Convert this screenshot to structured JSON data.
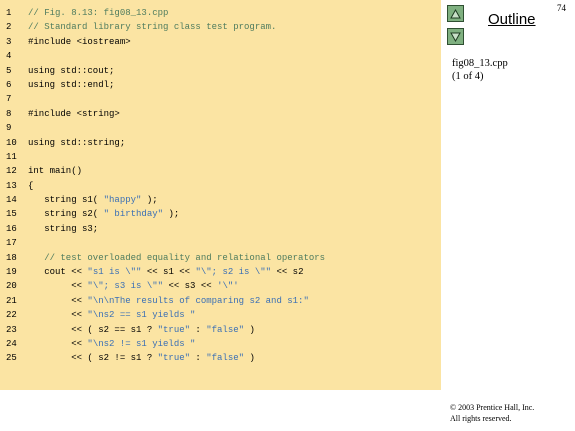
{
  "page_number": "74",
  "outline_label": "Outline",
  "nav": {
    "up_icon": "triangle-up-icon",
    "down_icon": "triangle-down-icon"
  },
  "file_info": {
    "filename": "fig08_13.cpp",
    "page_of": "(1 of 4)"
  },
  "copyright": {
    "line1": "© 2003 Prentice Hall, Inc.",
    "line2": "All rights reserved."
  },
  "colors": {
    "panel": "#fbe4a3",
    "comment": "#4f7c5e",
    "string": "#3a6fb5",
    "button": "#7fb080"
  },
  "code": [
    {
      "n": "1",
      "segs": [
        {
          "t": "// Fig. 8.13: fig08_13.cpp",
          "k": "comment"
        }
      ]
    },
    {
      "n": "2",
      "segs": [
        {
          "t": "// Standard library string class test program.",
          "k": "comment"
        }
      ]
    },
    {
      "n": "3",
      "segs": [
        {
          "t": "#include <iostream>",
          "k": "code"
        }
      ]
    },
    {
      "n": "4",
      "segs": []
    },
    {
      "n": "5",
      "segs": [
        {
          "t": "using std::cout;",
          "k": "code"
        }
      ]
    },
    {
      "n": "6",
      "segs": [
        {
          "t": "using std::endl;",
          "k": "code"
        }
      ]
    },
    {
      "n": "7",
      "segs": []
    },
    {
      "n": "8",
      "segs": [
        {
          "t": "#include <string>",
          "k": "code"
        }
      ]
    },
    {
      "n": "9",
      "segs": []
    },
    {
      "n": "10",
      "segs": [
        {
          "t": "using std::string;",
          "k": "code"
        }
      ]
    },
    {
      "n": "11",
      "segs": []
    },
    {
      "n": "12",
      "segs": [
        {
          "t": "int main()",
          "k": "code"
        }
      ]
    },
    {
      "n": "13",
      "segs": [
        {
          "t": "{",
          "k": "code"
        }
      ]
    },
    {
      "n": "14",
      "segs": [
        {
          "t": "   string s1( ",
          "k": "code"
        },
        {
          "t": "\"happy\"",
          "k": "string"
        },
        {
          "t": " );",
          "k": "code"
        }
      ]
    },
    {
      "n": "15",
      "segs": [
        {
          "t": "   string s2( ",
          "k": "code"
        },
        {
          "t": "\" birthday\"",
          "k": "string"
        },
        {
          "t": " );",
          "k": "code"
        }
      ]
    },
    {
      "n": "16",
      "segs": [
        {
          "t": "   string s3;",
          "k": "code"
        }
      ]
    },
    {
      "n": "17",
      "segs": []
    },
    {
      "n": "18",
      "segs": [
        {
          "t": "   // test overloaded equality and relational operators",
          "k": "comment"
        }
      ]
    },
    {
      "n": "19",
      "segs": [
        {
          "t": "   cout << ",
          "k": "code"
        },
        {
          "t": "\"s1 is \\\"\"",
          "k": "string"
        },
        {
          "t": " << s1 << ",
          "k": "code"
        },
        {
          "t": "\"\\\"; s2 is \\\"\"",
          "k": "string"
        },
        {
          "t": " << s2",
          "k": "code"
        }
      ]
    },
    {
      "n": "20",
      "segs": [
        {
          "t": "        << ",
          "k": "code"
        },
        {
          "t": "\"\\\"; s3 is \\\"\"",
          "k": "string"
        },
        {
          "t": " << s3 << ",
          "k": "code"
        },
        {
          "t": "'\\\"'",
          "k": "string"
        }
      ]
    },
    {
      "n": "21",
      "segs": [
        {
          "t": "        << ",
          "k": "code"
        },
        {
          "t": "\"\\n\\nThe results of comparing s2 and s1:\"",
          "k": "string"
        }
      ]
    },
    {
      "n": "22",
      "segs": [
        {
          "t": "        << ",
          "k": "code"
        },
        {
          "t": "\"\\ns2 == s1 yields \"",
          "k": "string"
        }
      ]
    },
    {
      "n": "23",
      "segs": [
        {
          "t": "        << ( s2 == s1 ? ",
          "k": "code"
        },
        {
          "t": "\"true\"",
          "k": "string"
        },
        {
          "t": " : ",
          "k": "code"
        },
        {
          "t": "\"false\"",
          "k": "string"
        },
        {
          "t": " )",
          "k": "code"
        }
      ]
    },
    {
      "n": "24",
      "segs": [
        {
          "t": "        << ",
          "k": "code"
        },
        {
          "t": "\"\\ns2 != s1 yields \"",
          "k": "string"
        }
      ]
    },
    {
      "n": "25",
      "segs": [
        {
          "t": "        << ( s2 != s1 ? ",
          "k": "code"
        },
        {
          "t": "\"true\"",
          "k": "string"
        },
        {
          "t": " : ",
          "k": "code"
        },
        {
          "t": "\"false\"",
          "k": "string"
        },
        {
          "t": " )",
          "k": "code"
        }
      ]
    }
  ]
}
